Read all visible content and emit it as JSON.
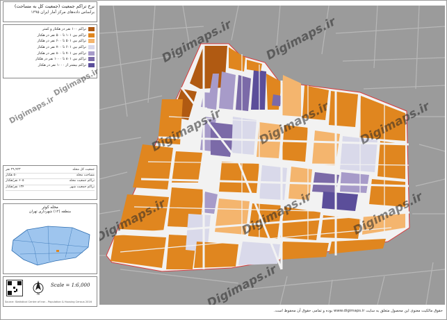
{
  "title": {
    "main": "نرخ تراکم جمعیت (جمعیت کل به مساحت)",
    "sub": "براساس داده‌های مرکز آمار ایران ۱۳۹۵"
  },
  "legend": [
    {
      "label": "تراکم ۱۰۰ نفر در هکتار و کمتر",
      "color": "#b05a12"
    },
    {
      "label": "تراکم بین ۱۰۱ تا ۵۰۰ نفر در هکتار",
      "color": "#e0861f"
    },
    {
      "label": "تراکم بین ۵۰۱ تا ۶۰۰ نفر در هکتار",
      "color": "#f4b56e"
    },
    {
      "label": "تراکم بین ۶۰۱ تا ۷۰۰ نفر در هکتار",
      "color": "#d9d9ea"
    },
    {
      "label": "تراکم بین ۷۰۱ تا ۸۰۰ نفر در هکتار",
      "color": "#a79bc9"
    },
    {
      "label": "تراکم بین ۸۰۱ تا ۱۰۰۰ نفر در هکتار",
      "color": "#7b6aa8"
    },
    {
      "label": "تراکم بیشتر از ۱۰۰۰ نفر در هکتار",
      "color": "#5b4e9a"
    }
  ],
  "stats": [
    {
      "label": "جمعیت کل محله",
      "value": "۲۹,۹۲۳ نفر"
    },
    {
      "label": "مساحت محله",
      "value": "۵۰ هکتار"
    },
    {
      "label": "تراکم جمعیت محله",
      "value": "۶۰۵ نفر/هکتار"
    },
    {
      "label": "تراکم جمعیت شهر",
      "value": "۱۳۴ نفر/هکتار"
    }
  ],
  "location": {
    "title": "محله کوثر",
    "sub": "منطقه (۱۲) شهرداری تهران"
  },
  "scale_text": "Scale = 1:6,000",
  "north_label": "N",
  "footnote": "Source: Statistical Centre of Iran - Population & Housing Census 2016",
  "bottom_note": "حقوق مالکیت معنوی این محصول متعلق به سایت www.digimaps.ir بوده و تمامی حقوق آن محفوظ است.",
  "watermark": "Digimaps.ir",
  "colors": {
    "street": "#f2f2f2",
    "background": "#9b9b9b",
    "boundary": "#d93a3a"
  }
}
